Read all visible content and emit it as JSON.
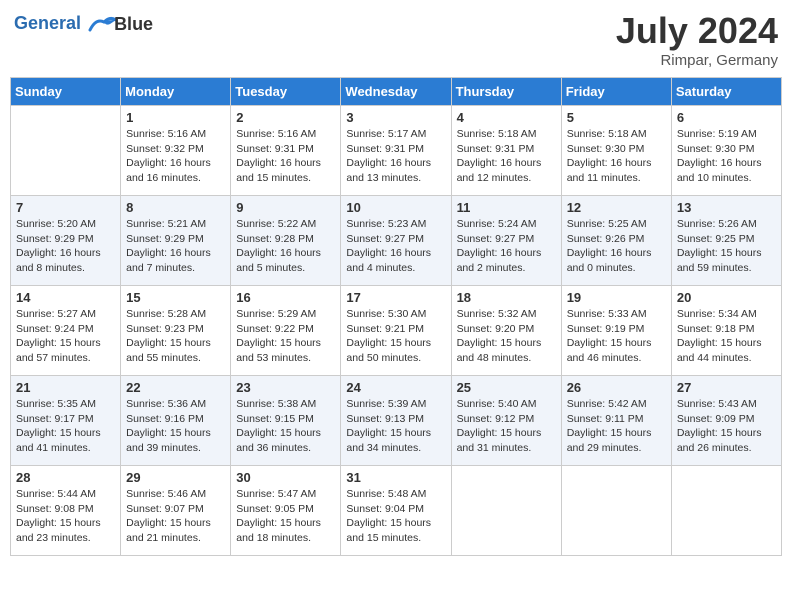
{
  "header": {
    "logo_line1": "General",
    "logo_line2": "Blue",
    "month_title": "July 2024",
    "location": "Rimpar, Germany"
  },
  "days_of_week": [
    "Sunday",
    "Monday",
    "Tuesday",
    "Wednesday",
    "Thursday",
    "Friday",
    "Saturday"
  ],
  "weeks": [
    [
      {
        "day": "",
        "sunrise": "",
        "sunset": "",
        "daylight": ""
      },
      {
        "day": "1",
        "sunrise": "Sunrise: 5:16 AM",
        "sunset": "Sunset: 9:32 PM",
        "daylight": "Daylight: 16 hours and 16 minutes."
      },
      {
        "day": "2",
        "sunrise": "Sunrise: 5:16 AM",
        "sunset": "Sunset: 9:31 PM",
        "daylight": "Daylight: 16 hours and 15 minutes."
      },
      {
        "day": "3",
        "sunrise": "Sunrise: 5:17 AM",
        "sunset": "Sunset: 9:31 PM",
        "daylight": "Daylight: 16 hours and 13 minutes."
      },
      {
        "day": "4",
        "sunrise": "Sunrise: 5:18 AM",
        "sunset": "Sunset: 9:31 PM",
        "daylight": "Daylight: 16 hours and 12 minutes."
      },
      {
        "day": "5",
        "sunrise": "Sunrise: 5:18 AM",
        "sunset": "Sunset: 9:30 PM",
        "daylight": "Daylight: 16 hours and 11 minutes."
      },
      {
        "day": "6",
        "sunrise": "Sunrise: 5:19 AM",
        "sunset": "Sunset: 9:30 PM",
        "daylight": "Daylight: 16 hours and 10 minutes."
      }
    ],
    [
      {
        "day": "7",
        "sunrise": "Sunrise: 5:20 AM",
        "sunset": "Sunset: 9:29 PM",
        "daylight": "Daylight: 16 hours and 8 minutes."
      },
      {
        "day": "8",
        "sunrise": "Sunrise: 5:21 AM",
        "sunset": "Sunset: 9:29 PM",
        "daylight": "Daylight: 16 hours and 7 minutes."
      },
      {
        "day": "9",
        "sunrise": "Sunrise: 5:22 AM",
        "sunset": "Sunset: 9:28 PM",
        "daylight": "Daylight: 16 hours and 5 minutes."
      },
      {
        "day": "10",
        "sunrise": "Sunrise: 5:23 AM",
        "sunset": "Sunset: 9:27 PM",
        "daylight": "Daylight: 16 hours and 4 minutes."
      },
      {
        "day": "11",
        "sunrise": "Sunrise: 5:24 AM",
        "sunset": "Sunset: 9:27 PM",
        "daylight": "Daylight: 16 hours and 2 minutes."
      },
      {
        "day": "12",
        "sunrise": "Sunrise: 5:25 AM",
        "sunset": "Sunset: 9:26 PM",
        "daylight": "Daylight: 16 hours and 0 minutes."
      },
      {
        "day": "13",
        "sunrise": "Sunrise: 5:26 AM",
        "sunset": "Sunset: 9:25 PM",
        "daylight": "Daylight: 15 hours and 59 minutes."
      }
    ],
    [
      {
        "day": "14",
        "sunrise": "Sunrise: 5:27 AM",
        "sunset": "Sunset: 9:24 PM",
        "daylight": "Daylight: 15 hours and 57 minutes."
      },
      {
        "day": "15",
        "sunrise": "Sunrise: 5:28 AM",
        "sunset": "Sunset: 9:23 PM",
        "daylight": "Daylight: 15 hours and 55 minutes."
      },
      {
        "day": "16",
        "sunrise": "Sunrise: 5:29 AM",
        "sunset": "Sunset: 9:22 PM",
        "daylight": "Daylight: 15 hours and 53 minutes."
      },
      {
        "day": "17",
        "sunrise": "Sunrise: 5:30 AM",
        "sunset": "Sunset: 9:21 PM",
        "daylight": "Daylight: 15 hours and 50 minutes."
      },
      {
        "day": "18",
        "sunrise": "Sunrise: 5:32 AM",
        "sunset": "Sunset: 9:20 PM",
        "daylight": "Daylight: 15 hours and 48 minutes."
      },
      {
        "day": "19",
        "sunrise": "Sunrise: 5:33 AM",
        "sunset": "Sunset: 9:19 PM",
        "daylight": "Daylight: 15 hours and 46 minutes."
      },
      {
        "day": "20",
        "sunrise": "Sunrise: 5:34 AM",
        "sunset": "Sunset: 9:18 PM",
        "daylight": "Daylight: 15 hours and 44 minutes."
      }
    ],
    [
      {
        "day": "21",
        "sunrise": "Sunrise: 5:35 AM",
        "sunset": "Sunset: 9:17 PM",
        "daylight": "Daylight: 15 hours and 41 minutes."
      },
      {
        "day": "22",
        "sunrise": "Sunrise: 5:36 AM",
        "sunset": "Sunset: 9:16 PM",
        "daylight": "Daylight: 15 hours and 39 minutes."
      },
      {
        "day": "23",
        "sunrise": "Sunrise: 5:38 AM",
        "sunset": "Sunset: 9:15 PM",
        "daylight": "Daylight: 15 hours and 36 minutes."
      },
      {
        "day": "24",
        "sunrise": "Sunrise: 5:39 AM",
        "sunset": "Sunset: 9:13 PM",
        "daylight": "Daylight: 15 hours and 34 minutes."
      },
      {
        "day": "25",
        "sunrise": "Sunrise: 5:40 AM",
        "sunset": "Sunset: 9:12 PM",
        "daylight": "Daylight: 15 hours and 31 minutes."
      },
      {
        "day": "26",
        "sunrise": "Sunrise: 5:42 AM",
        "sunset": "Sunset: 9:11 PM",
        "daylight": "Daylight: 15 hours and 29 minutes."
      },
      {
        "day": "27",
        "sunrise": "Sunrise: 5:43 AM",
        "sunset": "Sunset: 9:09 PM",
        "daylight": "Daylight: 15 hours and 26 minutes."
      }
    ],
    [
      {
        "day": "28",
        "sunrise": "Sunrise: 5:44 AM",
        "sunset": "Sunset: 9:08 PM",
        "daylight": "Daylight: 15 hours and 23 minutes."
      },
      {
        "day": "29",
        "sunrise": "Sunrise: 5:46 AM",
        "sunset": "Sunset: 9:07 PM",
        "daylight": "Daylight: 15 hours and 21 minutes."
      },
      {
        "day": "30",
        "sunrise": "Sunrise: 5:47 AM",
        "sunset": "Sunset: 9:05 PM",
        "daylight": "Daylight: 15 hours and 18 minutes."
      },
      {
        "day": "31",
        "sunrise": "Sunrise: 5:48 AM",
        "sunset": "Sunset: 9:04 PM",
        "daylight": "Daylight: 15 hours and 15 minutes."
      },
      {
        "day": "",
        "sunrise": "",
        "sunset": "",
        "daylight": ""
      },
      {
        "day": "",
        "sunrise": "",
        "sunset": "",
        "daylight": ""
      },
      {
        "day": "",
        "sunrise": "",
        "sunset": "",
        "daylight": ""
      }
    ]
  ]
}
